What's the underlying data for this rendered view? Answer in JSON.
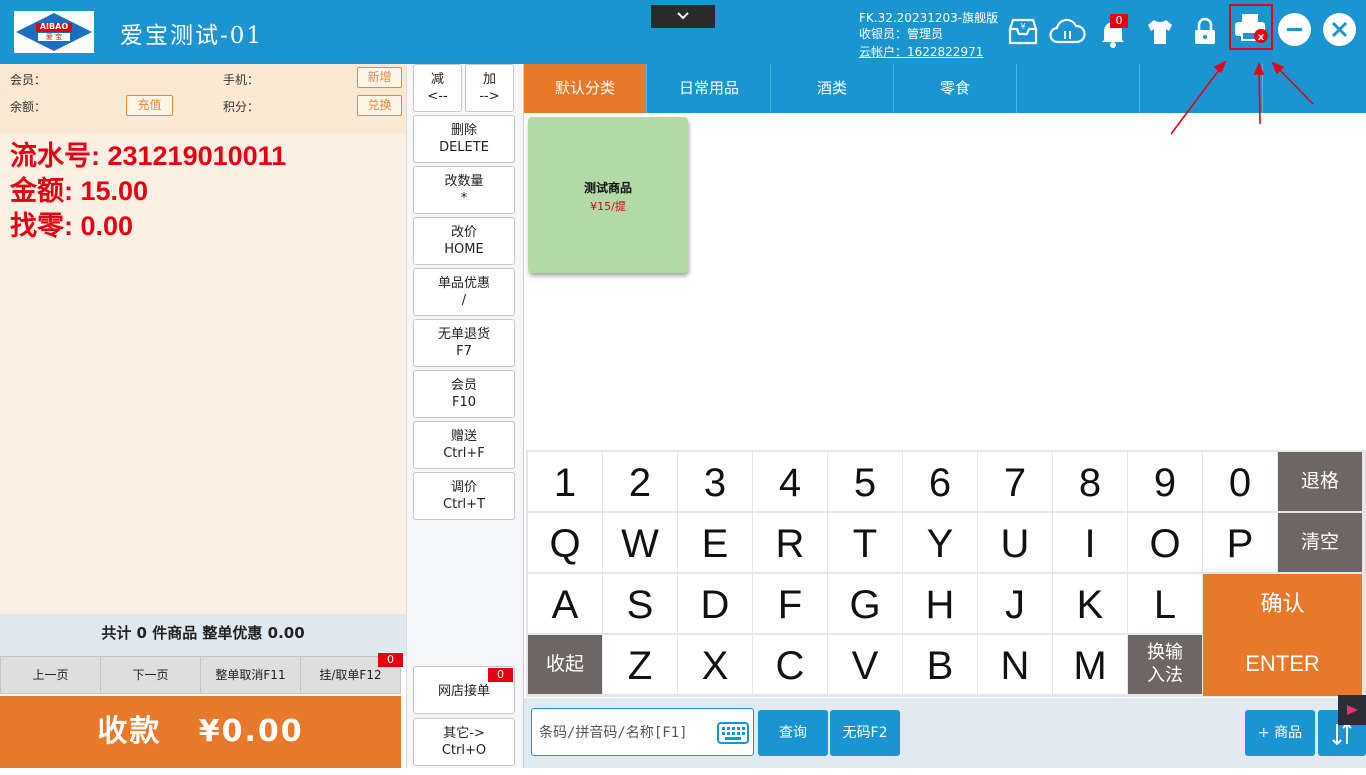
{
  "header": {
    "logo_text": "AIBAO",
    "logo_sub": "爱 宝",
    "title": "爱宝测试-01",
    "version": "FK.32.20231203-旗舰版",
    "cashier": "收银员：管理员",
    "cloud_account": "云帐户：1622822971",
    "notification_count": "0"
  },
  "member": {
    "member_label": "会员：",
    "phone_label": "手机：",
    "balance_label": "余额：",
    "points_label": "积分：",
    "add_label": "新增",
    "recharge_label": "充值",
    "redeem_label": "兑换"
  },
  "order": {
    "serial": "流水号: 231219010011",
    "amount": "金额: 15.00",
    "change": "找零: 0.00",
    "summary": "共计 0 件商品 整单优惠 0.00"
  },
  "pager": {
    "prev": "上一页",
    "next": "下一页",
    "cancel_order": "整单取消F11",
    "hold_order": "挂/取单F12",
    "hold_count": "0"
  },
  "pay": {
    "label": "收款",
    "amount": "¥0.00"
  },
  "functions": {
    "minus_top": "减",
    "minus_bottom": "<--",
    "plus_top": "加",
    "plus_bottom": "-->",
    "items": [
      {
        "label": "删除",
        "key": "DELETE"
      },
      {
        "label": "改数量",
        "key": "*"
      },
      {
        "label": "改价",
        "key": "HOME"
      },
      {
        "label": "单品优惠",
        "key": "/"
      },
      {
        "label": "无单退货",
        "key": "F7"
      },
      {
        "label": "会员",
        "key": "F10"
      },
      {
        "label": "赠送",
        "key": "Ctrl+F"
      },
      {
        "label": "调价",
        "key": "Ctrl+T"
      }
    ],
    "online_orders": "网店接单",
    "online_count": "0",
    "other_label": "其它->",
    "other_key": "Ctrl+O"
  },
  "categories": [
    "默认分类",
    "日常用品",
    "酒类",
    "零食"
  ],
  "products": [
    {
      "name": "测试商品",
      "price": "¥15/提"
    }
  ],
  "keyboard": {
    "row1": [
      "1",
      "2",
      "3",
      "4",
      "5",
      "6",
      "7",
      "8",
      "9",
      "0"
    ],
    "backspace": "退格",
    "row2": [
      "Q",
      "W",
      "E",
      "R",
      "T",
      "Y",
      "U",
      "I",
      "O",
      "P"
    ],
    "clear": "清空",
    "row3": [
      "A",
      "S",
      "D",
      "F",
      "G",
      "H",
      "J",
      "K",
      "L"
    ],
    "confirm": "确认",
    "enter": "ENTER",
    "collapse": "收起",
    "row4": [
      "Z",
      "X",
      "C",
      "V",
      "B",
      "N",
      "M"
    ],
    "switch_ime_1": "换输",
    "switch_ime_2": "入法"
  },
  "bottom": {
    "search_placeholder": "条码/拼音码/名称[F1]",
    "query": "查询",
    "no_barcode": "无码F2",
    "add_product": "+ 商品"
  },
  "colors": {
    "header_blue": "#1b95d1",
    "orange": "#e8782a",
    "red": "#e60012",
    "key_gray": "#6e6565",
    "product_green": "#b3d9a6"
  }
}
